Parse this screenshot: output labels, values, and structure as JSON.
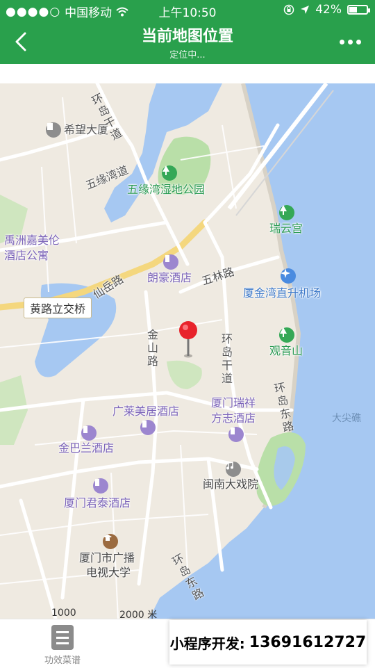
{
  "status": {
    "carrier": "中国移动",
    "time": "上午10:50",
    "battery": "42%",
    "battery_level": 0.42
  },
  "nav": {
    "title": "当前地图位置",
    "subtitle": "定位中..."
  },
  "map": {
    "places": {
      "xiwang": "希望大厦",
      "wuyuan_park": "五缘湾湿地公园",
      "ruiyun": "瑞云宫",
      "yuzhou_1": "禹洲嘉美伦",
      "yuzhou_2": "酒店公寓",
      "langhao": "朗豪酒店",
      "heliport": "厦金湾直升机场",
      "guanyin": "观音山",
      "guanglai": "广莱美居酒店",
      "ruixiang_1": "厦门瑞祥",
      "ruixiang_2": "方志酒店",
      "jinbalan": "金巴兰酒店",
      "minnan": "闽南大戏院",
      "juntai": "厦门君泰酒店",
      "tvu_1": "厦门市广播",
      "tvu_2": "电视大学",
      "dajianjiao": "大尖礁"
    },
    "roads": {
      "huandao_gan_top": "环岛干道",
      "wuyuan_bay": "五缘湾道",
      "xianyue": "仙岳路",
      "wulin": "五林路",
      "jinshan": "金山路",
      "huandao_gan_mid": "环岛干道",
      "huandao_east": "环岛东路",
      "huandao_south": "环岛东路",
      "huanglu_bridge": "黄路立交桥"
    },
    "scale_1": "1000",
    "scale_2": "2000 米"
  },
  "tabs": [
    {
      "label": "功效菜谱"
    }
  ],
  "promo": {
    "label": "小程序开发:",
    "phone": "13691612727"
  }
}
